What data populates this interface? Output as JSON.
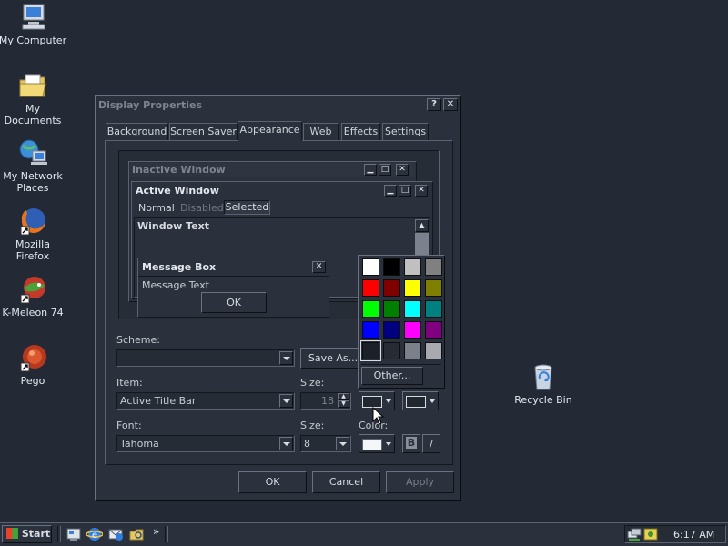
{
  "desktop": {
    "icons": [
      {
        "label": "My Computer",
        "icon": "computer-icon"
      },
      {
        "label": "My Documents",
        "icon": "folder-icon"
      },
      {
        "label": "My Network Places",
        "icon": "network-icon"
      },
      {
        "label": "Mozilla Firefox",
        "icon": "firefox-icon"
      },
      {
        "label": "K-Meleon 74",
        "icon": "kmeleon-icon"
      },
      {
        "label": "Pego",
        "icon": "pego-icon"
      },
      {
        "label": "Recycle Bin",
        "icon": "recycle-bin-icon"
      }
    ]
  },
  "dialog": {
    "title": "Display Properties",
    "help_glyph": "?",
    "close_glyph": "✕",
    "tabs": [
      "Background",
      "Screen Saver",
      "Appearance",
      "Web",
      "Effects",
      "Settings"
    ],
    "active_tab": "Appearance",
    "preview": {
      "inactive_title": "Inactive Window",
      "active_title": "Active Window",
      "menu": [
        "Normal",
        "Disabled",
        "Selected"
      ],
      "window_text": "Window Text",
      "msgbox_title": "Message Box",
      "msgbox_text": "Message Text",
      "msgbox_ok": "OK"
    },
    "scheme_label": "Scheme:",
    "scheme_value": "",
    "save_as_label": "Save As...",
    "item_label": "Item:",
    "item_value": "Active Title Bar",
    "item_size_label": "Size:",
    "item_size_value": "18",
    "color_label": "Color:",
    "font_label": "Font:",
    "font_value": "Tahoma",
    "font_size_label": "Size:",
    "font_size_value": "8",
    "bold_label": "B",
    "italic_label": "/",
    "ok_label": "OK",
    "cancel_label": "Cancel",
    "apply_label": "Apply"
  },
  "color_popup": {
    "colors": [
      "#ffffff",
      "#000000",
      "#c0c0c0",
      "#808080",
      "#ff0000",
      "#800000",
      "#ffff00",
      "#808000",
      "#00ff00",
      "#008000",
      "#00ffff",
      "#008080",
      "#0000ff",
      "#000080",
      "#ff00ff",
      "#800080",
      "#1c2028",
      "#262b34",
      "#7c8088",
      "#a8aab0"
    ],
    "selected_index": 16,
    "other_label": "Other..."
  },
  "taskbar": {
    "start_label": "Start",
    "more_glyph": "»",
    "clock": "6:17 AM"
  }
}
